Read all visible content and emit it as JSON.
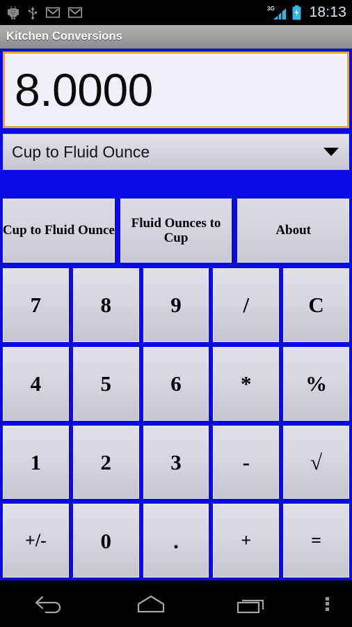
{
  "status_bar": {
    "icons": [
      "android-robot-icon",
      "usb-icon",
      "gmail-icon",
      "gmail-icon"
    ],
    "network_type": "3G",
    "signal": "signal-bars-icon",
    "battery": "battery-charging-icon",
    "time": "18:13"
  },
  "title_bar": {
    "title": "Kitchen Conversions"
  },
  "display": {
    "value": "8.0000"
  },
  "spinner": {
    "selected": "Cup to Fluid Ounce",
    "arrow": "chevron-down-icon"
  },
  "tabs": [
    {
      "label": "Cup to Fluid Ounce"
    },
    {
      "label": "Fluid Ounces to Cup"
    },
    {
      "label": "About"
    }
  ],
  "keypad": {
    "keys": [
      {
        "label": "7",
        "name": "key-7"
      },
      {
        "label": "8",
        "name": "key-8"
      },
      {
        "label": "9",
        "name": "key-9"
      },
      {
        "label": "/",
        "name": "key-divide"
      },
      {
        "label": "C",
        "name": "key-clear"
      },
      {
        "label": "4",
        "name": "key-4"
      },
      {
        "label": "5",
        "name": "key-5"
      },
      {
        "label": "6",
        "name": "key-6"
      },
      {
        "label": "*",
        "name": "key-multiply"
      },
      {
        "label": "%",
        "name": "key-percent"
      },
      {
        "label": "1",
        "name": "key-1"
      },
      {
        "label": "2",
        "name": "key-2"
      },
      {
        "label": "3",
        "name": "key-3"
      },
      {
        "label": "-",
        "name": "key-minus"
      },
      {
        "label": "√",
        "name": "key-sqrt"
      },
      {
        "label": "+/-",
        "name": "key-sign"
      },
      {
        "label": "0",
        "name": "key-0"
      },
      {
        "label": ".",
        "name": "key-decimal"
      },
      {
        "label": "+",
        "name": "key-plus"
      },
      {
        "label": "=",
        "name": "key-equals"
      }
    ]
  },
  "nav_bar": {
    "back": "back-arrow-icon",
    "home": "home-icon",
    "recents": "recents-icon",
    "menu": "overflow-menu-icon"
  },
  "colors": {
    "background_blue": "#0a0ae8",
    "display_border_orange": "#f3a033",
    "display_bg": "#f0f0f8",
    "button_face": "#d6d6e0",
    "status_accent": "#33b5e5"
  }
}
